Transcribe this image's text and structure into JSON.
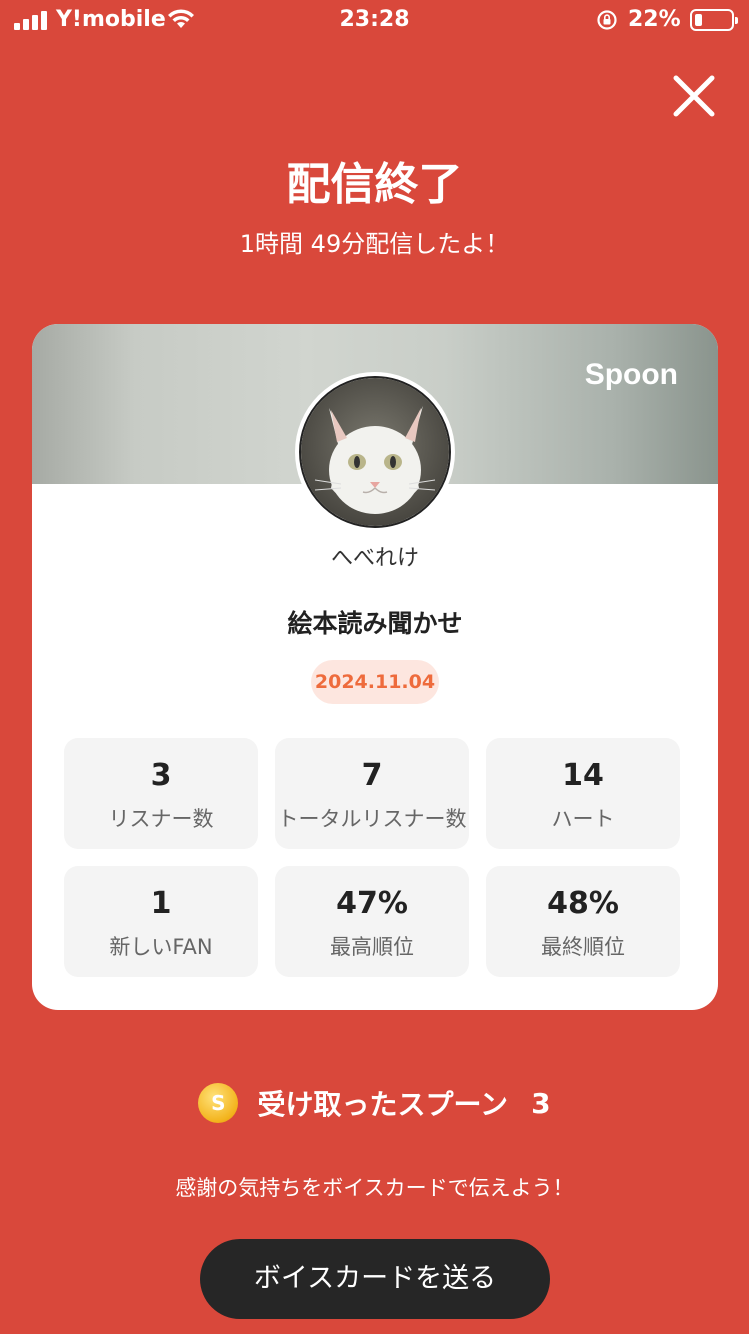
{
  "status_bar": {
    "carrier": "Y!mobile",
    "time": "23:28",
    "battery": "22%",
    "battery_level": 0.22,
    "icons": [
      "signal-icon",
      "wifi-icon",
      "rotation-lock-icon",
      "battery-icon"
    ]
  },
  "header": {
    "close_icon": "close-icon",
    "title": "配信終了",
    "subtitle": "1時間 49分配信したよ！"
  },
  "card": {
    "brand": "Spoon",
    "username": "へべれけ",
    "stream_title": "絵本読み聞かせ",
    "date": "2024.11.04",
    "stats": [
      {
        "value": "3",
        "label": "リスナー数"
      },
      {
        "value": "7",
        "label": "トータルリスナー数"
      },
      {
        "value": "14",
        "label": "ハート"
      },
      {
        "value": "1",
        "label": "新しいFAN"
      },
      {
        "value": "47%",
        "label": "最高順位"
      },
      {
        "value": "48%",
        "label": "最終順位"
      }
    ]
  },
  "spoons": {
    "coin_icon": "spoon-coin-icon",
    "coin_glyph": "S",
    "label": "受け取ったスプーン",
    "count": "3"
  },
  "footer": {
    "thanks": "感謝の気持ちをボイスカードで伝えよう！",
    "send_button": "ボイスカードを送る"
  },
  "colors": {
    "background": "#d9483b",
    "button": "#262626",
    "date_text": "#ee6b3c",
    "date_bg": "#fde6df"
  }
}
